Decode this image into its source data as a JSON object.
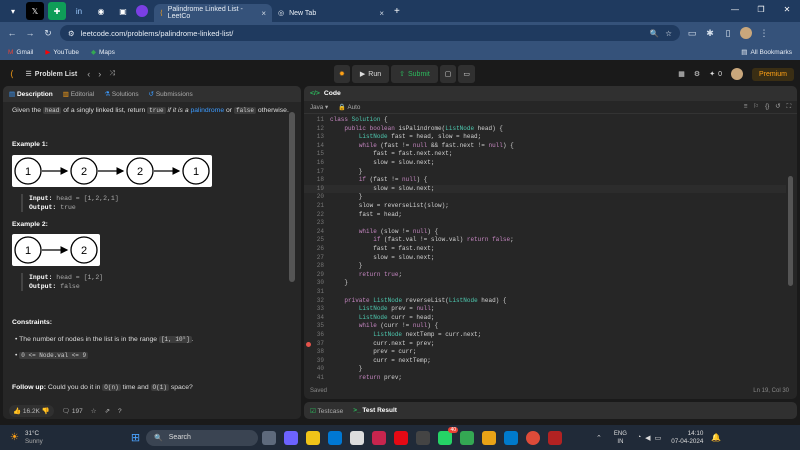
{
  "browser": {
    "tabs": [
      {
        "label": "Palindrome Linked List - LeetCo",
        "active": true
      },
      {
        "label": "New Tab",
        "active": false
      }
    ],
    "url": "leetcode.com/problems/palindrome-linked-list/",
    "bookmarks": [
      "Gmail",
      "YouTube",
      "Maps"
    ],
    "all_bookmarks": "All Bookmarks"
  },
  "leetcode": {
    "problem_list": "Problem List",
    "run": "Run",
    "submit": "Submit",
    "streak": "0",
    "premium": "Premium"
  },
  "left": {
    "tabs": [
      "Description",
      "Editorial",
      "Solutions",
      "Submissions"
    ],
    "desc_line": {
      "p1": "Given the ",
      "c1": "head",
      "p2": " of a singly linked list, return ",
      "c2": "true",
      "p3": " if it is a ",
      "link": "palindrome",
      "p4": " or ",
      "c3": "false",
      "p5": " otherwise."
    },
    "ex1_title": "Example 1:",
    "ex1_nodes": [
      "1",
      "2",
      "2",
      "1"
    ],
    "ex1_input_label": "Input:",
    "ex1_input": " head = [1,2,2,1]",
    "ex1_output_label": "Output:",
    "ex1_output": " true",
    "ex2_title": "Example 2:",
    "ex2_nodes": [
      "1",
      "2"
    ],
    "ex2_input_label": "Input:",
    "ex2_input": " head = [1,2]",
    "ex2_output_label": "Output:",
    "ex2_output": " false",
    "constraints_title": "Constraints:",
    "con1_p": "The number of nodes in the list is in the range ",
    "con1_c": "[1, 10⁵]",
    "con1_e": ".",
    "con2_c": "0 <= Node.val <= 9",
    "followup_b": "Follow up:",
    "followup_p1": " Could you do it in ",
    "followup_c1": "O(n)",
    "followup_p2": " time and ",
    "followup_c2": "O(1)",
    "followup_p3": " space?",
    "likes": "16.2K",
    "comments": "197"
  },
  "right": {
    "title": "Code",
    "lang": "Java",
    "mode": "Auto",
    "saved": "Saved",
    "cursor": "Ln 19, Col 30",
    "lines": [
      {
        "n": "11",
        "t": "class Solution {"
      },
      {
        "n": "12",
        "t": "    public boolean isPalindrome(ListNode head) {"
      },
      {
        "n": "13",
        "t": "        ListNode fast = head, slow = head;"
      },
      {
        "n": "14",
        "t": "        while (fast != null && fast.next != null) {"
      },
      {
        "n": "15",
        "t": "            fast = fast.next.next;"
      },
      {
        "n": "16",
        "t": "            slow = slow.next;"
      },
      {
        "n": "17",
        "t": "        }"
      },
      {
        "n": "18",
        "t": "        if (fast != null) {"
      },
      {
        "n": "19",
        "t": "            slow = slow.next;"
      },
      {
        "n": "20",
        "t": "        }"
      },
      {
        "n": "21",
        "t": "        slow = reverseList(slow);"
      },
      {
        "n": "22",
        "t": "        fast = head;"
      },
      {
        "n": "23",
        "t": ""
      },
      {
        "n": "24",
        "t": "        while (slow != null) {"
      },
      {
        "n": "25",
        "t": "            if (fast.val != slow.val) return false;"
      },
      {
        "n": "26",
        "t": "            fast = fast.next;"
      },
      {
        "n": "27",
        "t": "            slow = slow.next;"
      },
      {
        "n": "28",
        "t": "        }"
      },
      {
        "n": "29",
        "t": "        return true;"
      },
      {
        "n": "30",
        "t": "    }"
      },
      {
        "n": "31",
        "t": ""
      },
      {
        "n": "32",
        "t": "    private ListNode reverseList(ListNode head) {"
      },
      {
        "n": "33",
        "t": "        ListNode prev = null;"
      },
      {
        "n": "34",
        "t": "        ListNode curr = head;"
      },
      {
        "n": "35",
        "t": "        while (curr != null) {"
      },
      {
        "n": "36",
        "t": "            ListNode nextTemp = curr.next;"
      },
      {
        "n": "37",
        "t": "            curr.next = prev;"
      },
      {
        "n": "38",
        "t": "            prev = curr;"
      },
      {
        "n": "39",
        "t": "            curr = nextTemp;"
      },
      {
        "n": "40",
        "t": "        }"
      },
      {
        "n": "41",
        "t": "        return prev;"
      }
    ],
    "testcase": "Testcase",
    "test_result": "Test Result"
  },
  "taskbar": {
    "temp": "31°C",
    "weather": "Sunny",
    "search": "Search",
    "lang1": "ENG",
    "lang2": "IN",
    "time": "14:10",
    "date": "07-04-2024",
    "chat_badge": "40"
  },
  "colors": {
    "accent_green": "#2cbb5d",
    "premium": "#ffa116",
    "link": "#3c9bff"
  }
}
